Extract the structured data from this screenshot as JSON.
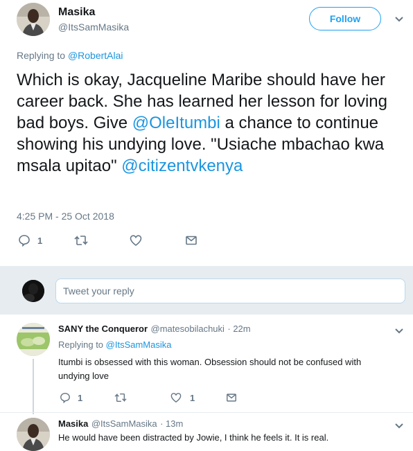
{
  "main_tweet": {
    "author_name": "Masika",
    "author_handle": "@ItsSamMasika",
    "follow_label": "Follow",
    "replying_prefix": "Replying to ",
    "replying_to": "@RobertAlai",
    "text_part1": "Which is okay, Jacqueline Maribe should have her career back. She has learned her lesson for loving bad boys. Give ",
    "mention1": "@OleItumbi",
    "text_part2": " a chance to continue showing his undying love. \"Usiache mbachao kwa msala upitao\" ",
    "mention2": "@citizentvkenya",
    "timestamp": "4:25 PM - 25 Oct 2018",
    "reply_count": "1",
    "icons": [
      "reply-icon",
      "retweet-icon",
      "like-icon",
      "message-icon"
    ]
  },
  "reply_box": {
    "placeholder": "Tweet your reply"
  },
  "replies": [
    {
      "author_name": "SANY the Conqueror",
      "author_handle": "@matesobilachuki",
      "time": "· 22m",
      "replying_prefix": "Replying to ",
      "replying_to": "@ItsSamMasika",
      "text": "Itumbi is obsessed with this woman. Obsession should not be confused with undying love",
      "reply_count": "1",
      "like_count": "1"
    },
    {
      "author_name": "Masika",
      "author_handle": "@ItsSamMasika",
      "time": "· 13m",
      "text": "He would have been distracted by Jowie,  I think he feels it. It is real."
    }
  ],
  "colors": {
    "accent": "#1da1f2",
    "link": "#1b95e0",
    "secondary_text": "#657786",
    "band": "#e6ecf0"
  }
}
